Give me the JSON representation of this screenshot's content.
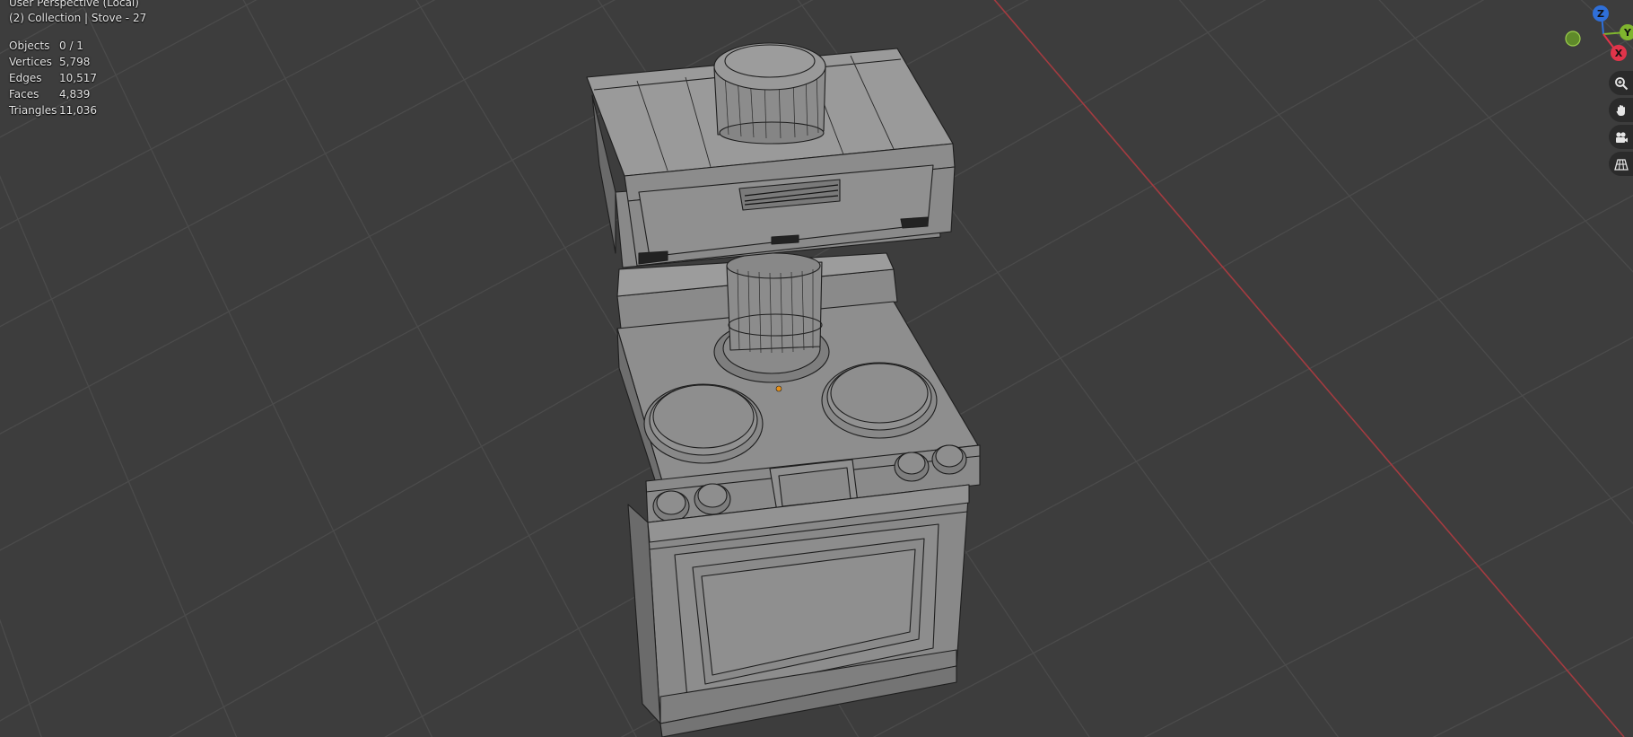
{
  "viewport": {
    "view_name": "User Perspective (Local)",
    "collection_line": "(2) Collection | Stove - 27"
  },
  "stats": [
    {
      "label": "Objects",
      "value": "0 / 1"
    },
    {
      "label": "Vertices",
      "value": "5,798"
    },
    {
      "label": "Edges",
      "value": "10,517"
    },
    {
      "label": "Faces",
      "value": "4,839"
    },
    {
      "label": "Triangles",
      "value": "11,036"
    }
  ],
  "gizmo": {
    "axes": [
      {
        "label": "Z",
        "color": "#2f6fd8"
      },
      {
        "label": "Y",
        "color": "#7fb52e"
      },
      {
        "label": "X",
        "color": "#e0344a"
      }
    ]
  },
  "nav_tools": [
    {
      "name": "zoom-tool",
      "icon": "magnify-plus-icon"
    },
    {
      "name": "pan-tool",
      "icon": "hand-icon"
    },
    {
      "name": "camera-view-tool",
      "icon": "camera-icon"
    },
    {
      "name": "perspective-toggle",
      "icon": "grid-icon"
    }
  ],
  "colors": {
    "background": "#3d3d3d",
    "grid_line": "#4b4b4b",
    "x_axis_line": "#a43b40",
    "mesh_fill": "#8e8e8e",
    "mesh_wire": "#1e1e1e"
  }
}
